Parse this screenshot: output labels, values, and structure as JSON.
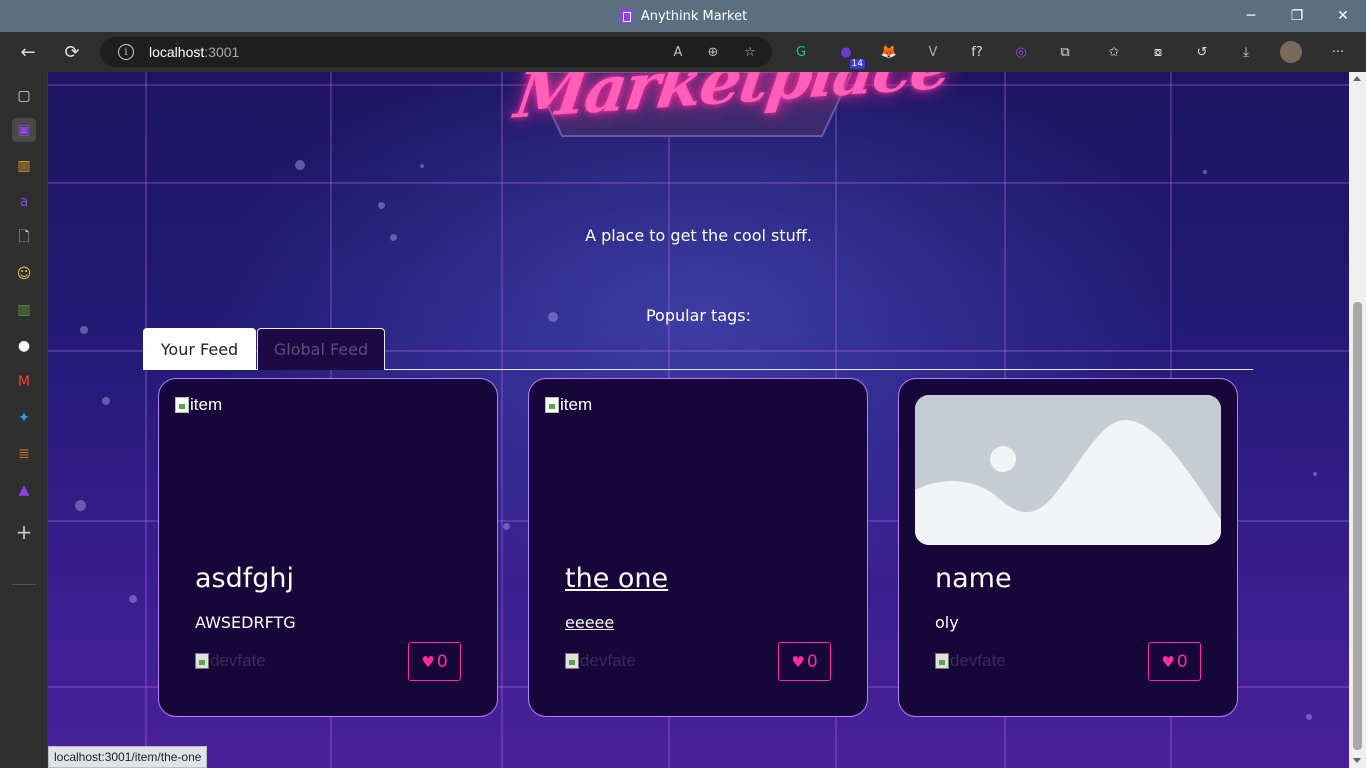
{
  "window": {
    "title": "Anythink Market",
    "minimize": "─",
    "restore": "❐",
    "close": "✕"
  },
  "toolbar": {
    "back_icon": "←",
    "refresh_icon": "⟳",
    "url_host": "localhost",
    "url_port": ":3001",
    "info_icon": "i",
    "read_aloud": "A",
    "zoom": "⊕",
    "favorite": "☆",
    "extensions": [
      {
        "name": "grammarly",
        "glyph": "G",
        "color": "#15c39a"
      },
      {
        "name": "extension-badge",
        "glyph": "●",
        "color": "#6a3bd1",
        "badge": "14"
      },
      {
        "name": "metamask",
        "glyph": "🦊",
        "color": "#e2761b"
      },
      {
        "name": "vue-devtools",
        "glyph": "V",
        "color": "#aaaaaa"
      },
      {
        "name": "font-ninja",
        "glyph": "f?",
        "color": "#dddddd"
      },
      {
        "name": "purple-ext",
        "glyph": "◎",
        "color": "#8c46e6"
      }
    ],
    "puzzle": "⧉",
    "favorites": "✩",
    "collections": "⧇",
    "history": "↺",
    "downloads": "⤓",
    "more": "···"
  },
  "sidebar": {
    "items": [
      {
        "name": "tabs-icon",
        "glyph": "▢",
        "color": "#dddddd"
      },
      {
        "name": "anythink-icon",
        "glyph": "▣",
        "color": "#8c46e6"
      },
      {
        "name": "chart-icon",
        "glyph": "▥",
        "color": "#e0a020"
      },
      {
        "name": "dark-a-icon",
        "glyph": "a",
        "color": "#8c46e6"
      },
      {
        "name": "document-icon",
        "glyph": "🗋",
        "color": "#dddddd"
      },
      {
        "name": "emoji-icon",
        "glyph": "☺",
        "color": "#f5c242"
      },
      {
        "name": "chart2-icon",
        "glyph": "▥",
        "color": "#6a9a3a"
      },
      {
        "name": "github-icon",
        "glyph": "●",
        "color": "#ffffff"
      },
      {
        "name": "gmail-icon",
        "glyph": "M",
        "color": "#ea4335"
      },
      {
        "name": "twitter-icon",
        "glyph": "✦",
        "color": "#1da1f2"
      },
      {
        "name": "stack-icon",
        "glyph": "≣",
        "color": "#b56d2b"
      },
      {
        "name": "rocket-icon",
        "glyph": "▲",
        "color": "#8c46e6"
      }
    ],
    "add": "+"
  },
  "hero": {
    "logo_text": "Marketplace",
    "tagline": "A place to get the cool stuff.",
    "popular_tags": "Popular tags:"
  },
  "tabs": {
    "your_feed": "Your Feed",
    "global_feed": "Global Feed"
  },
  "items": [
    {
      "title": "asdfghj",
      "description": "AWSEDRFTG",
      "image_alt": "item",
      "author_alt": "devfate",
      "favorites": "0",
      "heart": "♥"
    },
    {
      "title": "the one",
      "description": "eeeee",
      "image_alt": "item",
      "author_alt": "devfate",
      "favorites": "0",
      "heart": "♥"
    },
    {
      "title": "name",
      "description": "oly",
      "image_alt": "",
      "author_alt": "devfate",
      "favorites": "0",
      "heart": "♥"
    }
  ],
  "statusbar": {
    "link": "localhost:3001/item/the-one"
  }
}
